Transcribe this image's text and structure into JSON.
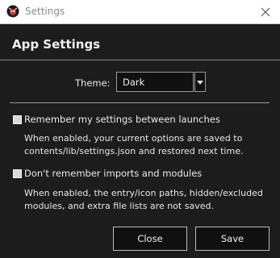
{
  "window": {
    "title": "Settings"
  },
  "page": {
    "heading": "App Settings"
  },
  "theme": {
    "label": "Theme:",
    "selected": "Dark"
  },
  "options": [
    {
      "label": "Remember my settings between launches",
      "checked": false,
      "description_lines": [
        "When enabled, your current options are saved to",
        "contents/lib/settings.json and restored next time."
      ]
    },
    {
      "label": "Don't remember imports and modules",
      "checked": false,
      "description_lines": [
        "When enabled, the entry/icon paths, hidden/excluded",
        "modules, and extra file lists are not saved."
      ]
    }
  ],
  "buttons": {
    "close": "Close",
    "save": "Save"
  },
  "icons": {
    "app": "app-logo-icon",
    "close": "close-icon",
    "dropdown": "chevron-down-icon"
  },
  "colors": {
    "background": "#1c1c1c",
    "titlebar": "#ffffff",
    "input_background": "#101010",
    "border": "#9a9a9a",
    "text": "#e6e6e6"
  }
}
